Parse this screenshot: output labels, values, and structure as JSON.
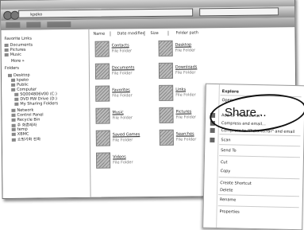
{
  "address": {
    "path": "kpeko"
  },
  "nav": {
    "items": [
      {
        "label": "Favorite Links",
        "indent": 0
      },
      {
        "label": "Documents",
        "indent": 0
      },
      {
        "label": "Pictures",
        "indent": 0
      },
      {
        "label": "Music",
        "indent": 0
      },
      {
        "label": "More »",
        "indent": 2
      },
      {
        "label": "Folders",
        "indent": 0
      },
      {
        "label": "Desktop",
        "indent": 1
      },
      {
        "label": "kpeko",
        "indent": 2
      },
      {
        "label": "Public",
        "indent": 2
      },
      {
        "label": "Computer",
        "indent": 2
      },
      {
        "label": "SQ004806V00 (C:)",
        "indent": 3
      },
      {
        "label": "DVD RW Drive (D:)",
        "indent": 3
      },
      {
        "label": "My Sharing Folders",
        "indent": 3
      },
      {
        "label": "Network",
        "indent": 2
      },
      {
        "label": "Control Panel",
        "indent": 2
      },
      {
        "label": "Recycle Bin",
        "indent": 2
      },
      {
        "label": "주 화흔레라",
        "indent": 2
      },
      {
        "label": "temp",
        "indent": 2
      },
      {
        "label": "XBMC",
        "indent": 2
      },
      {
        "label": "쇼핑기화    전화",
        "indent": 2
      }
    ]
  },
  "columns": {
    "name": "Name",
    "date": "Date modified",
    "size": "Size",
    "path": "Folder path"
  },
  "files": [
    {
      "name": "Contacts",
      "type": "File Folder"
    },
    {
      "name": "Documents",
      "type": "File Folder"
    },
    {
      "name": "Favorites",
      "type": "File Folder"
    },
    {
      "name": "Music",
      "type": "File Folder"
    },
    {
      "name": "Saved Games",
      "type": "File Folder"
    },
    {
      "name": "Videos",
      "type": "File Folder"
    },
    {
      "name": "Desktop",
      "type": "File Folder"
    },
    {
      "name": "Downloads",
      "type": "File Folder"
    },
    {
      "name": "Links",
      "type": "File Folder"
    },
    {
      "name": "Pictures",
      "type": "File Folder"
    },
    {
      "name": "Searches",
      "type": "File Folder"
    }
  ],
  "context_menu": {
    "items": [
      {
        "label": "Explore",
        "bold": true
      },
      {
        "label": "Open"
      },
      {
        "label": "Share..."
      },
      {
        "label": "Add to \"Pictures.rar\""
      },
      {
        "label": "Compress and email..."
      },
      {
        "label": "Compress to \"Pictures.rar\" and email"
      },
      {
        "label": "Scan"
      },
      {
        "label": "Send To"
      },
      {
        "label": "Cut"
      },
      {
        "label": "Copy"
      },
      {
        "label": "Create Shortcut"
      },
      {
        "label": "Delete"
      },
      {
        "label": "Rename"
      },
      {
        "label": "Properties"
      }
    ]
  },
  "icons": [
    "back-icon",
    "forward-icon",
    "folder-icon",
    "disk-icon",
    "scan-icon"
  ],
  "colors": {
    "ring": "#111111",
    "chrome": "#9c9c9c"
  }
}
